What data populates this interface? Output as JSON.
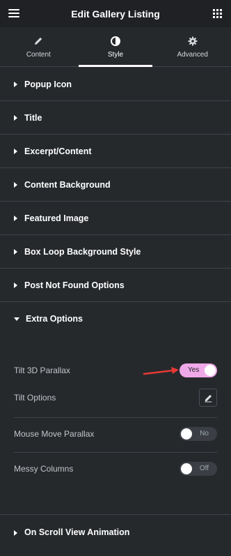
{
  "header": {
    "title": "Edit Gallery Listing",
    "menu_icon": "hamburger-icon",
    "apps_icon": "grid-icon"
  },
  "tabs": [
    {
      "label": "Content",
      "icon": "pencil-icon"
    },
    {
      "label": "Style",
      "icon": "contrast-icon"
    },
    {
      "label": "Advanced",
      "icon": "gear-icon"
    }
  ],
  "active_tab": "Style",
  "sections": [
    {
      "label": "Popup Icon"
    },
    {
      "label": "Title"
    },
    {
      "label": "Excerpt/Content"
    },
    {
      "label": "Content Background"
    },
    {
      "label": "Featured Image"
    },
    {
      "label": "Box Loop Background Style"
    },
    {
      "label": "Post Not Found Options"
    },
    {
      "label": "Extra Options"
    }
  ],
  "extra_options": {
    "tilt_3d_parallax": {
      "label": "Tilt 3D Parallax",
      "value": "Yes"
    },
    "tilt_options": {
      "label": "Tilt Options",
      "icon": "pencil-icon"
    },
    "mouse_move_parallax": {
      "label": "Mouse Move Parallax",
      "value": "No"
    },
    "messy_columns": {
      "label": "Messy Columns",
      "value": "Off"
    }
  },
  "last_section": {
    "label": "On Scroll View Animation"
  },
  "colors": {
    "toggle_on": "#f0a9e8",
    "arrow": "#e53935",
    "panel": "#26292c"
  }
}
